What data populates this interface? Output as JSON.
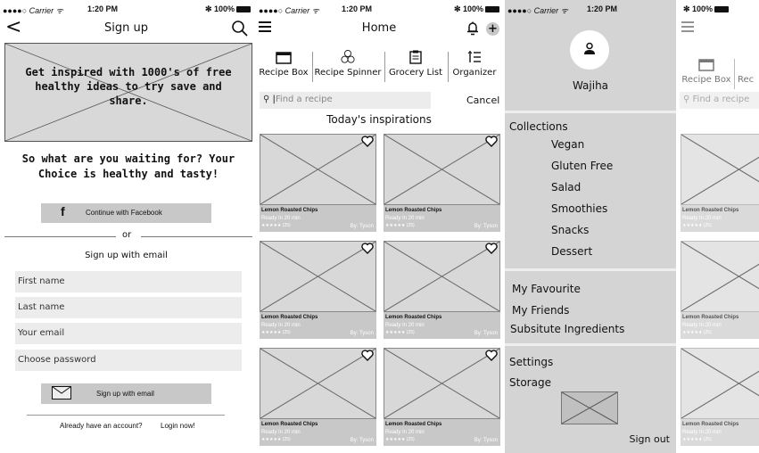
{
  "status": {
    "carrier": "●●●●○ Carrier ᯤ",
    "time": "1:20 PM",
    "battery": "✻ 100%"
  },
  "signup": {
    "title": "Sign up",
    "hero_text": "Get inspired with 1000's of free healthy ideas to try save and share.",
    "promo": "So what are you waiting for? Your Choice is healthy and tasty!",
    "facebook_label": "Continue with Facebook",
    "facebook_icon_text": "f",
    "or": "or",
    "email_heading": "Sign up with email",
    "fields": [
      "First name",
      "Last name",
      "Your email",
      "Choose password"
    ],
    "email_button": "Sign up with email",
    "already": "Already have an account?",
    "login_now": "Login now!"
  },
  "home": {
    "title": "Home",
    "plus": "+",
    "tools": [
      "Recipe Box",
      "Recipe Spinner",
      "Grocery List",
      "Organizer"
    ],
    "search_placeholder": "Find a recipe",
    "cancel": "Cancel",
    "section_title": "Today's inspirations",
    "cards": [
      {
        "title": "Lemon Roasted Chips",
        "ready": "Ready In  20 min",
        "rating": "★★★★★ (25)",
        "by": "By: Tyson"
      },
      {
        "title": "Lemon Roasted Chips",
        "ready": "Ready In  20 min",
        "rating": "★★★★★ (25)",
        "by": "By: Tyson"
      },
      {
        "title": "Lemon Roasted Chips",
        "ready": "Ready In  20 min",
        "rating": "★★★★★ (25)",
        "by": "By: Tyson"
      },
      {
        "title": "Lemon Roasted Chips",
        "ready": "Ready In  20 min",
        "rating": "★★★★★ (25)",
        "by": "By: Tyson"
      },
      {
        "title": "Lemon Roasted Chips",
        "ready": "Ready In  20 min",
        "rating": "★★★★★ (25)",
        "by": "By: Tyson"
      },
      {
        "title": "Lemon Roasted Chips",
        "ready": "Ready In  20 min",
        "rating": "★★★★★ (25)",
        "by": "By: Tyson"
      }
    ]
  },
  "menu": {
    "user": "Wajiha",
    "collections": "Collections",
    "collection_items": [
      "Vegan",
      "Gluten Free",
      "Salad",
      "Smoothies",
      "Snacks",
      "Dessert"
    ],
    "my_items": [
      "My Favourite",
      "My Friends",
      "Subsitute Ingredients"
    ],
    "settings": "Settings",
    "storage": "Storage",
    "sign_out": "Sign out"
  },
  "peek": {
    "tools": [
      "Recipe Box",
      "Rec"
    ],
    "search_placeholder": "Find a recipe",
    "cards": [
      {
        "title": "Lemon Roasted Chips",
        "ready": "Ready In  20 min",
        "rating": "★★★★★ (25)"
      },
      {
        "title": "Lemon Roasted Chips",
        "ready": "Ready In  20 min",
        "rating": "★★★★★ (25)"
      },
      {
        "title": "Lemon Roasted Chips",
        "ready": "Ready In  20 min",
        "rating": "★★★★★ (25)"
      }
    ]
  }
}
